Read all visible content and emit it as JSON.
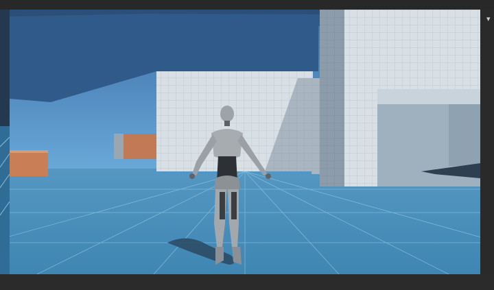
{
  "editor": {
    "right_panel": {
      "dropdown_icon": "chevron-down-icon",
      "dropdown_glyph": "▾"
    }
  },
  "colors": {
    "sky": "#3f73b3",
    "overhang": "#2f5680",
    "floor": "#4b8fb8",
    "wall_light": "#d9e0e6",
    "wall_shade": "#aebbc6",
    "crate": "#c97e56",
    "character": "#9ea3a8",
    "editor_chrome": "#2b2b2b"
  }
}
